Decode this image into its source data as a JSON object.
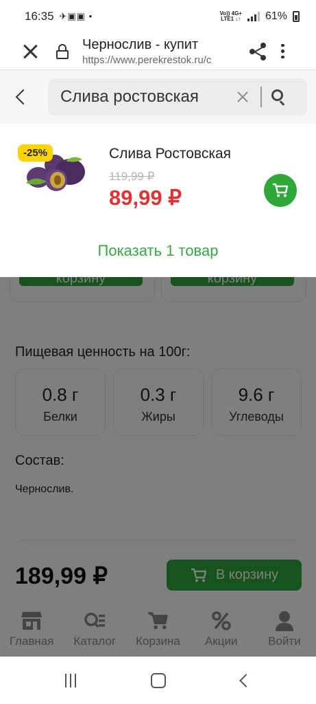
{
  "status_bar": {
    "time": "16:35",
    "notif_icons": "✈▣▣ •",
    "network_top": "Vo)) 4G+",
    "network_bottom": "LTE1 ↓↑",
    "battery": "61%"
  },
  "browser": {
    "title": "Чернослив - купит",
    "url": "https://www.perekrestok.ru/c"
  },
  "search": {
    "value": "Слива ростовская"
  },
  "suggestion": {
    "discount": "-25%",
    "name": "Слива Ростовская",
    "old_price": "119,99 ₽",
    "new_price": "89,99 ₽",
    "show_all": "Показать 1 товар"
  },
  "page": {
    "card_button_label": "корзину",
    "nutrition_title": "Пищевая ценность на 100г:",
    "nutrition": [
      {
        "value": "0.8 г",
        "label": "Белки"
      },
      {
        "value": "0.3 г",
        "label": "Жиры"
      },
      {
        "value": "9.6 г",
        "label": "Углеводы"
      }
    ],
    "composition_title": "Состав:",
    "composition_text": "Чернослив.",
    "price": "189,99 ₽",
    "add_to_cart": "В корзину"
  },
  "tabs": [
    {
      "label": "Главная",
      "icon": "store-icon"
    },
    {
      "label": "Каталог",
      "icon": "catalog-search-icon"
    },
    {
      "label": "Корзина",
      "icon": "cart-icon"
    },
    {
      "label": "Акции",
      "icon": "percent-icon"
    },
    {
      "label": "Войти",
      "icon": "user-icon"
    }
  ],
  "colors": {
    "accent_green": "#2fa83a",
    "price_red": "#e03232",
    "badge_yellow": "#ffd400",
    "link_green": "#35a83f"
  }
}
